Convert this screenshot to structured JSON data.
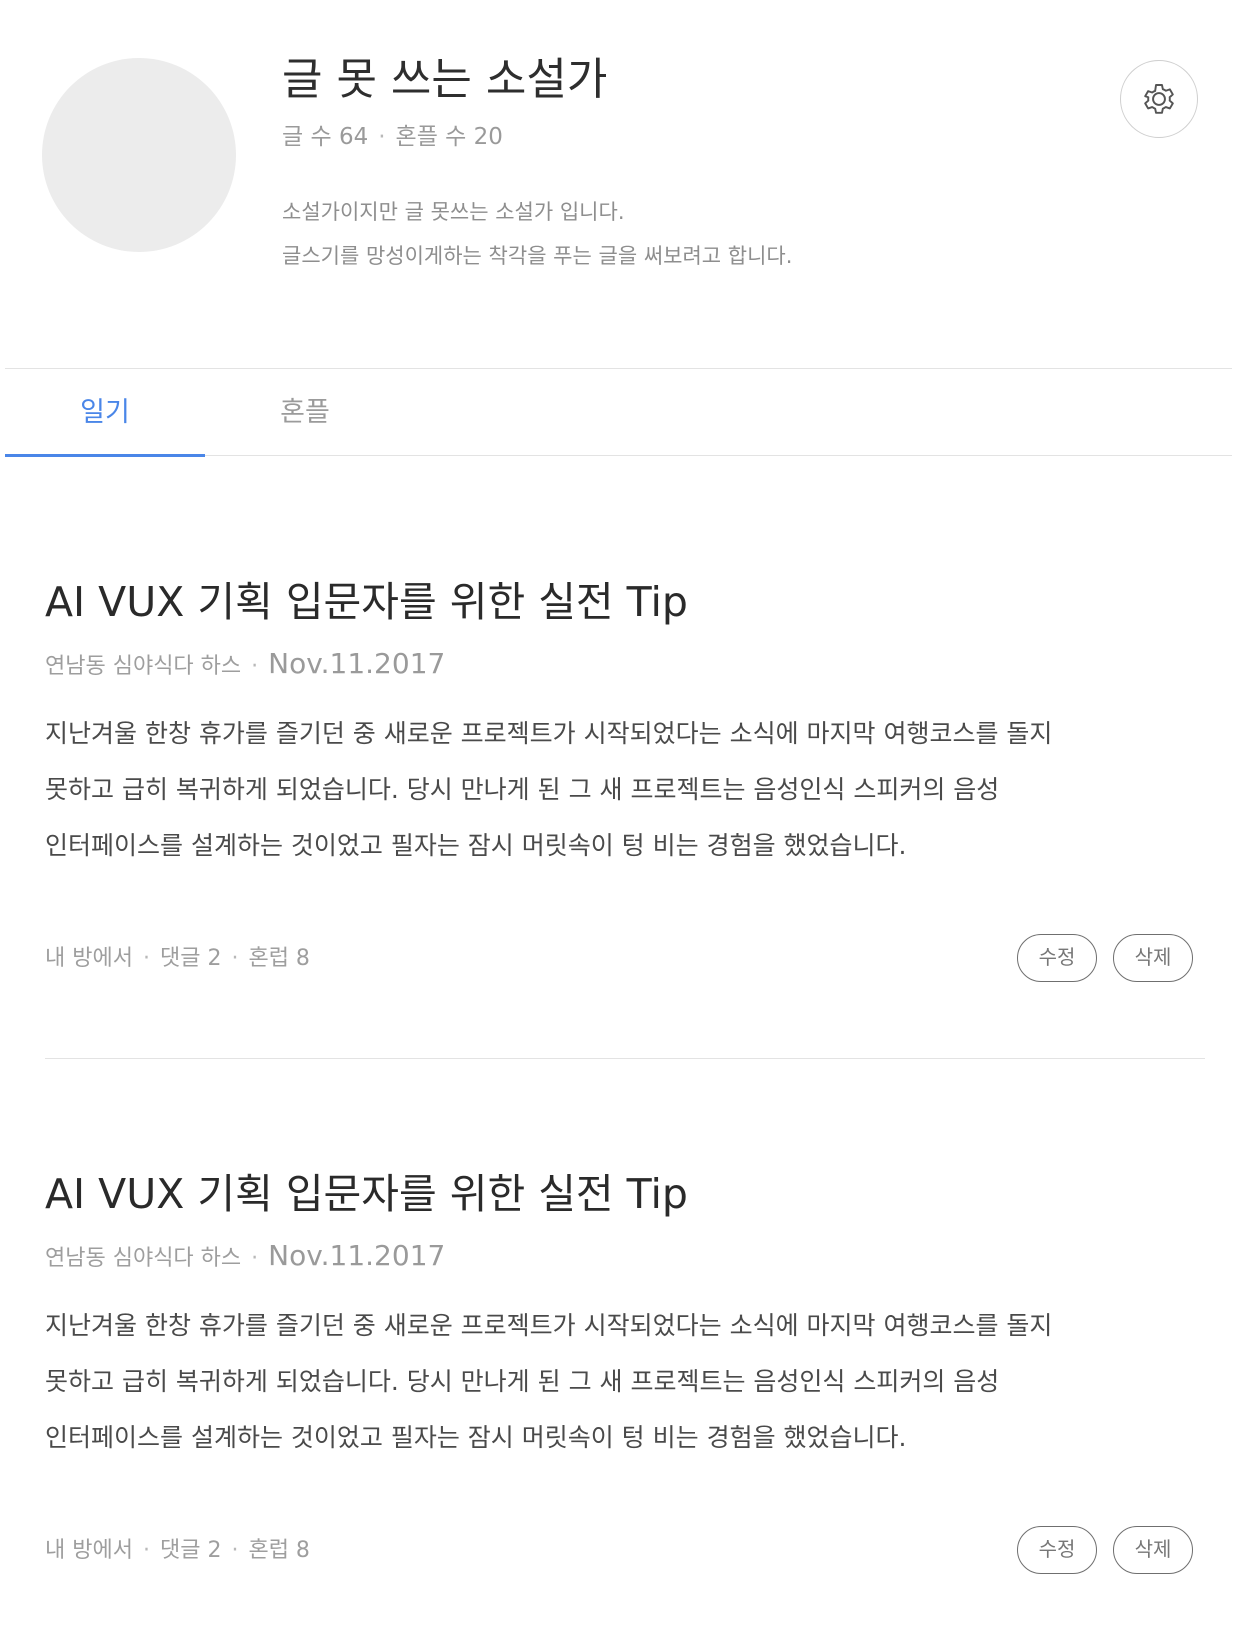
{
  "profile": {
    "name": "글 못 쓰는 소설가",
    "stats": {
      "posts": "글 수 64",
      "honpeul": "혼플 수 20"
    },
    "bio": [
      "소설가이지만 글 못쓰는 소설가 입니다.",
      "글스기를 망성이게하는 착각을 푸는 글을 써보려고 합니다."
    ],
    "settings_icon": "gear-icon"
  },
  "tabs": [
    {
      "label": "일기",
      "active": true
    },
    {
      "label": "혼플",
      "active": false
    }
  ],
  "posts": [
    {
      "title": "AI VUX 기획 입문자를 위한 실전 Tip",
      "author": "연남동 심야식다 하스",
      "date": "Nov.11.2017",
      "body": [
        "지난겨울 한창 휴가를 즐기던 중 새로운 프로젝트가 시작되었다는 소식에 마지막 여행코스를 돌지",
        "못하고 급히 복귀하게 되었습니다. 당시 만나게 된 그 새 프로젝트는 음성인식 스피커의 음성",
        "인터페이스를 설계하는 것이었고 필자는 잠시 머릿속이 텅 비는 경험을 했었습니다."
      ],
      "location": "내 방에서",
      "comments": "댓글 2",
      "honreop": "혼럽 8",
      "edit_label": "수정",
      "delete_label": "삭제"
    },
    {
      "title": "AI VUX 기획 입문자를 위한 실전 Tip",
      "author": "연남동 심야식다 하스",
      "date": "Nov.11.2017",
      "body": [
        "지난겨울 한창 휴가를 즐기던 중 새로운 프로젝트가 시작되었다는 소식에 마지막 여행코스를 돌지",
        "못하고 급히 복귀하게 되었습니다. 당시 만나게 된 그 새 프로젝트는 음성인식 스피커의 음성",
        "인터페이스를 설계하는 것이었고 필자는 잠시 머릿속이 텅 비는 경험을 했었습니다."
      ],
      "location": "내 방에서",
      "comments": "댓글 2",
      "honreop": "혼럽 8",
      "edit_label": "수정",
      "delete_label": "삭제"
    }
  ],
  "colors": {
    "accent": "#4a86e8",
    "avatar_placeholder": "#ececec",
    "divider": "#e3e3e3"
  }
}
